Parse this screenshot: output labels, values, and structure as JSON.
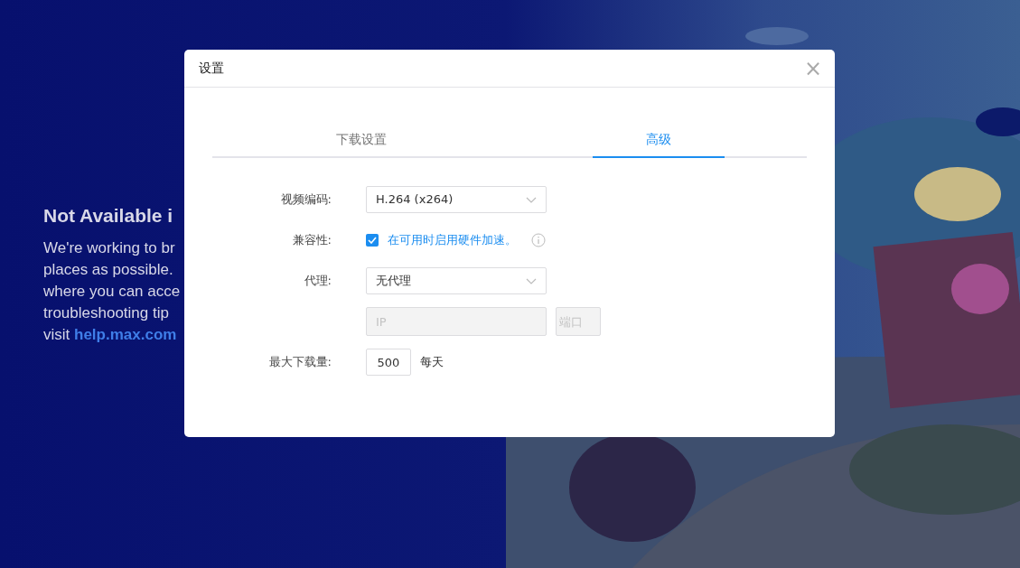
{
  "background": {
    "heading": "Not Available i",
    "lines": [
      "We're working to br",
      "places as possible.",
      "where you can acce",
      "troubleshooting tip"
    ],
    "last_line": {
      "text": "visit",
      "link": "help.max.com"
    }
  },
  "dialog": {
    "title": "设置",
    "close": "×",
    "tabs": [
      {
        "label": "下载设置",
        "selected": false
      },
      {
        "label": "高级",
        "selected": true
      }
    ],
    "fields": [
      {
        "kind": "select",
        "label": "视频编码:",
        "value": "H.264 (x264)"
      },
      {
        "kind": "checkbox",
        "label": "兼容性:",
        "text": "在可用时启用硬件加速。",
        "checked": true
      },
      {
        "kind": "select",
        "label": "代理:",
        "value": "无代理"
      },
      {
        "kind": "pair",
        "inputs": [
          {
            "placeholder": "IP",
            "disabled": true
          },
          {
            "placeholder": "端口",
            "disabled": true
          }
        ]
      },
      {
        "kind": "number",
        "label": "最大下载量:",
        "value": "500",
        "unit": "每天"
      }
    ]
  }
}
